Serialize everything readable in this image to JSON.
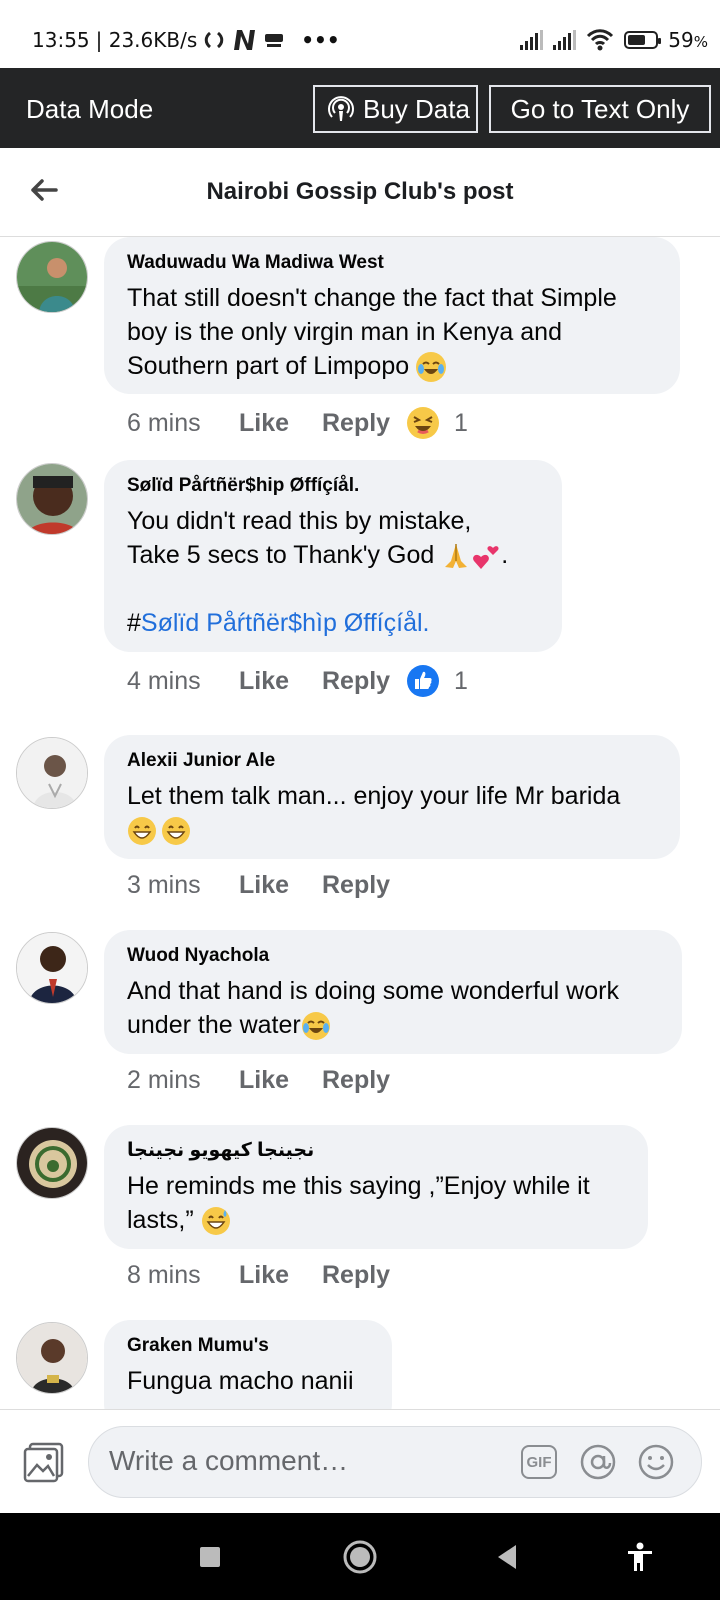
{
  "status_bar": {
    "time": "13:55",
    "net_speed": "| 23.6KB/s",
    "more": "•••",
    "battery": "59",
    "battery_unit": "%"
  },
  "data_bar": {
    "mode_label": "Data Mode",
    "buy_label": "Buy Data",
    "text_only_label": "Go to Text Only"
  },
  "header": {
    "title": "Nairobi Gossip Club's post"
  },
  "comments": [
    {
      "author": "Waduwadu Wa Madiwa West",
      "text": "That still doesn't change the fact that Simple boy is the only virgin man in Kenya and Southern part of Limpopo",
      "time": "6 mins",
      "like": "Like",
      "reply": "Reply",
      "reaction": "laughing",
      "reaction_count": "1"
    },
    {
      "author": "Sølïd Påŕtñër$hip Øffíçíål.",
      "text_line1": "You didn't read this by mistake,",
      "text_line2": "Take 5 secs to Thank'y God",
      "hashtag_prefix": "#",
      "hashtag": "Sølïd Påŕtñër$hìp Øffíçíål.",
      "time": "4 mins",
      "like": "Like",
      "reply": "Reply",
      "reaction": "like",
      "reaction_count": "1"
    },
    {
      "author": "Alexii Junior Ale",
      "text": "Let them talk man... enjoy your life Mr barida",
      "time": "3 mins",
      "like": "Like",
      "reply": "Reply"
    },
    {
      "author": "Wuod Nyachola",
      "text": "And that hand is doing some wonderful work under the water",
      "time": "2 mins",
      "like": "Like",
      "reply": "Reply"
    },
    {
      "author": "نجينجا كيهويو نجينجا",
      "text": "He reminds me this saying ,”Enjoy while it lasts,”",
      "time": "8 mins",
      "like": "Like",
      "reply": "Reply"
    },
    {
      "author": "Graken Mumu's",
      "text": "Fungua macho nanii"
    }
  ],
  "composer": {
    "placeholder": "Write a comment…",
    "gif_label": "GIF"
  },
  "colors": {
    "data_bar_bg": "#242526",
    "bubble_bg": "#f0f2f5",
    "link_blue": "#216fdb",
    "meta_gray": "#65676b",
    "like_blue": "#1877f2"
  },
  "icons": [
    "back-arrow-icon",
    "podcast-icon",
    "photo-icon",
    "gif-icon",
    "at-icon",
    "smile-icon",
    "square-icon",
    "home-circle-icon",
    "back-triangle-icon",
    "accessibility-icon"
  ]
}
